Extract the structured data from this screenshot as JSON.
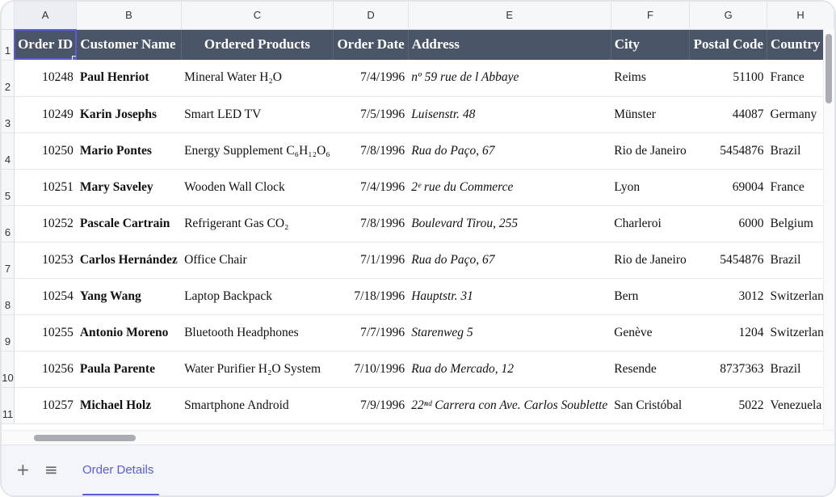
{
  "columns": [
    "A",
    "B",
    "C",
    "D",
    "E",
    "F",
    "G",
    "H"
  ],
  "headers": {
    "order_id": "Order ID",
    "customer_name": "Customer Name",
    "ordered_products": "Ordered Products",
    "order_date": "Order Date",
    "address": "Address",
    "city": "City",
    "postal_code": "Postal Code",
    "country": "Country"
  },
  "rows": [
    {
      "num": "2",
      "id": "10248",
      "customer": "Paul Henriot",
      "product": "Mineral Water H₂O",
      "date": "7/4/1996",
      "address": "nº 59 rue de l Abbaye",
      "city": "Reims",
      "postal": "51100",
      "country": "France"
    },
    {
      "num": "3",
      "id": "10249",
      "customer": "Karin Josephs",
      "product": "Smart LED TV",
      "date": "7/5/1996",
      "address": "Luisenstr. 48",
      "city": "Münster",
      "postal": "44087",
      "country": "Germany"
    },
    {
      "num": "4",
      "id": "10250",
      "customer": "Mario Pontes",
      "product": "Energy Supplement C₆H₁₂O₆",
      "date": "7/8/1996",
      "address": "Rua do Paço, 67",
      "city": "Rio de Janeiro",
      "postal": "5454876",
      "country": "Brazil"
    },
    {
      "num": "5",
      "id": "10251",
      "customer": "Mary Saveley",
      "product": "Wooden Wall Clock",
      "date": "7/4/1996",
      "address": "2ᵉ rue du Commerce",
      "city": "Lyon",
      "postal": "69004",
      "country": "France"
    },
    {
      "num": "6",
      "id": "10252",
      "customer": "Pascale Cartrain",
      "product": "Refrigerant Gas CO₂",
      "date": "7/8/1996",
      "address": "Boulevard Tirou, 255",
      "city": "Charleroi",
      "postal": "6000",
      "country": "Belgium"
    },
    {
      "num": "7",
      "id": "10253",
      "customer": "Carlos Hernández",
      "product": "Office Chair",
      "date": "7/1/1996",
      "address": "Rua do Paço, 67",
      "city": "Rio de Janeiro",
      "postal": "5454876",
      "country": "Brazil"
    },
    {
      "num": "8",
      "id": "10254",
      "customer": "Yang Wang",
      "product": "Laptop Backpack",
      "date": "7/18/1996",
      "address": "Hauptstr. 31",
      "city": "Bern",
      "postal": "3012",
      "country": "Switzerland"
    },
    {
      "num": "9",
      "id": "10255",
      "customer": "Antonio Moreno",
      "product": "Bluetooth Headphones",
      "date": "7/7/1996",
      "address": "Starenweg 5",
      "city": "Genève",
      "postal": "1204",
      "country": "Switzerland"
    },
    {
      "num": "10",
      "id": "10256",
      "customer": "Paula Parente",
      "product": "Water Purifier H₂O System",
      "date": "7/10/1996",
      "address": "Rua do Mercado, 12",
      "city": "Resende",
      "postal": "8737363",
      "country": "Brazil"
    },
    {
      "num": "11",
      "id": "10257",
      "customer": "Michael Holz",
      "product": "Smartphone Android",
      "date": "7/9/1996",
      "address": "22ⁿᵈ Carrera con Ave. Carlos Soublette",
      "city": "San Cristóbal",
      "postal": "5022",
      "country": "Venezuela"
    }
  ],
  "header_row_num": "1",
  "sheet_tab": "Order Details",
  "icons": {
    "add": "plus-icon",
    "menu": "hamburger-menu-icon"
  },
  "accent_color": "#5b5bd6",
  "header_fill": "#4a5568"
}
